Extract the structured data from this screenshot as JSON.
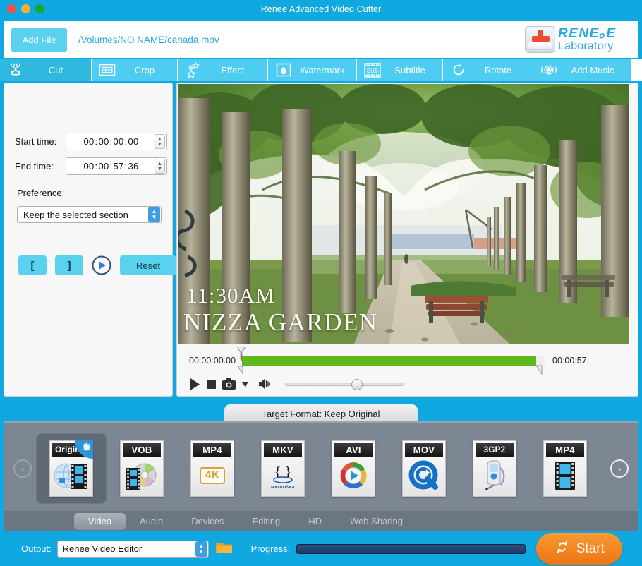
{
  "window": {
    "title": "Renee Advanced Video Cutter",
    "traffic_lights": [
      "close",
      "minimize",
      "zoom"
    ]
  },
  "filebar": {
    "add_file_label": "Add File",
    "file_path": "/Volumes/NO NAME/canada.mov",
    "logo_top": "RENEₒE",
    "logo_bottom": "Laboratory"
  },
  "nav": {
    "tabs": [
      {
        "label": "Cut",
        "icon": "scissors-icon",
        "active": true
      },
      {
        "label": "Crop",
        "icon": "crop-frame-icon",
        "active": false
      },
      {
        "label": "Effect",
        "icon": "stars-icon",
        "active": false
      },
      {
        "label": "Watermark",
        "icon": "watermark-drop-icon",
        "active": false
      },
      {
        "label": "Subtitle",
        "icon": "subtitle-film-icon",
        "active": false
      },
      {
        "label": "Rotate",
        "icon": "rotate-arrow-icon",
        "active": false
      },
      {
        "label": "Add Music",
        "icon": "speaker-waves-icon",
        "active": false
      }
    ]
  },
  "cut_panel": {
    "start_time_label": "Start time:",
    "start_time": {
      "h": "00",
      "m": "00",
      "s": "00",
      "f": "00"
    },
    "end_time_label": "End time:",
    "end_time": {
      "h": "00",
      "m": "00",
      "s": "57",
      "f": "36"
    },
    "preference_label": "Preference:",
    "preference_value": "Keep the selected section",
    "mark_in_label": "[",
    "mark_out_label": "]",
    "preview_icon": "play-circle-icon",
    "reset_label": "Reset"
  },
  "preview": {
    "overlay_line1": "11:30AM",
    "overlay_line2": "NIZZA GARDEN",
    "timeline_start": "00:00:00.00",
    "timeline_end": "00:00:57",
    "fill_percent": 97,
    "controls": [
      "play-icon",
      "stop-icon",
      "snapshot-icon",
      "snapshot-dropdown-icon",
      "volume-icon"
    ],
    "volume_percent": 60
  },
  "target_format": {
    "tab_label": "Target Format: Keep Original",
    "prev_label": "‹",
    "next_label": "›",
    "formats": [
      {
        "name": "Original",
        "cap": "Original",
        "icon": "globe-film-icon",
        "selected": true,
        "has_gear": true
      },
      {
        "name": "VOB",
        "cap": "VOB",
        "icon": "disc-film-icon",
        "selected": false,
        "has_gear": false
      },
      {
        "name": "MP4 4K",
        "cap": "MP4",
        "icon": "4k-badge-icon",
        "selected": false,
        "has_gear": false
      },
      {
        "name": "MKV",
        "cap": "MKV",
        "icon": "matroska-icon",
        "selected": false,
        "has_gear": false
      },
      {
        "name": "AVI",
        "cap": "AVI",
        "icon": "color-wheel-play-icon",
        "selected": false,
        "has_gear": false
      },
      {
        "name": "MOV",
        "cap": "MOV",
        "icon": "quicktime-q-icon",
        "selected": false,
        "has_gear": false
      },
      {
        "name": "3GP2",
        "cap": "3GP2",
        "icon": "mobile-phone-icon",
        "selected": false,
        "has_gear": false
      },
      {
        "name": "MP4",
        "cap": "MP4",
        "icon": "film-strip-icon",
        "selected": false,
        "has_gear": false
      }
    ],
    "categories": [
      {
        "label": "Video",
        "active": true
      },
      {
        "label": "Audio",
        "active": false
      },
      {
        "label": "Devices",
        "active": false
      },
      {
        "label": "Editing",
        "active": false
      },
      {
        "label": "HD",
        "active": false
      },
      {
        "label": "Web Sharing",
        "active": false
      }
    ],
    "fourk_badge": "4K",
    "matroska_text": "MATROŠKA"
  },
  "bottom": {
    "output_label": "Output:",
    "output_value": "Renee Video Editor",
    "folder_icon": "folder-icon",
    "progress_label": "Progress:",
    "progress_percent": 0,
    "start_label": "Start",
    "start_icon": "refresh-icon"
  },
  "colors": {
    "brand_blue": "#0fa8e0",
    "tab_blue": "#4ecdf2",
    "active_tab_blue": "#2fb9e0",
    "accent_orange": "#ee7414",
    "timeline_green": "#5eb81c",
    "panel_gray": "#7d8793"
  }
}
